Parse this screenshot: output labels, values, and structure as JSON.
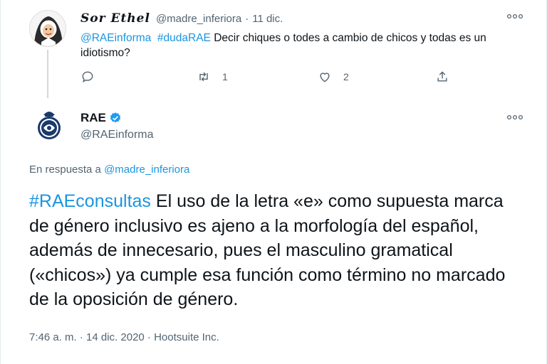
{
  "reply_tweet": {
    "display_name": "Sor Ethel",
    "handle": "@madre_inferiora",
    "separator": "·",
    "date": "11 dic.",
    "mention": "@RAEinforma",
    "hashtag": "#dudaRAE",
    "text": "Decir chiques o todes a cambio de chicos y todas es un idiotismo?",
    "more": "ooo",
    "actions": {
      "reply_icon": "comment-icon",
      "retweet_icon": "retweet-icon",
      "retweet_count": "1",
      "like_icon": "heart-icon",
      "like_count": "2",
      "share_icon": "share-icon"
    }
  },
  "main_tweet": {
    "display_name": "RAE",
    "verified_icon": "verified-badge-icon",
    "handle": "@RAEinforma",
    "more": "ooo",
    "in_reply_prefix": "En respuesta a",
    "in_reply_handle": "@madre_inferiora",
    "hashtag": "#RAEconsultas",
    "text": "El uso de la letra «e» como supuesta marca de género inclusivo es ajeno a la morfología del español, además de innecesario, pues el masculino gramatical («chicos») ya cumple esa función como término no marcado de la oposición de género.",
    "timestamp": "7:46 a. m. · 14 dic. 2020 · Hootsuite Inc."
  },
  "colors": {
    "link": "#1b95e0",
    "secondary_text": "#536471",
    "verified": "#1d9bf0"
  }
}
